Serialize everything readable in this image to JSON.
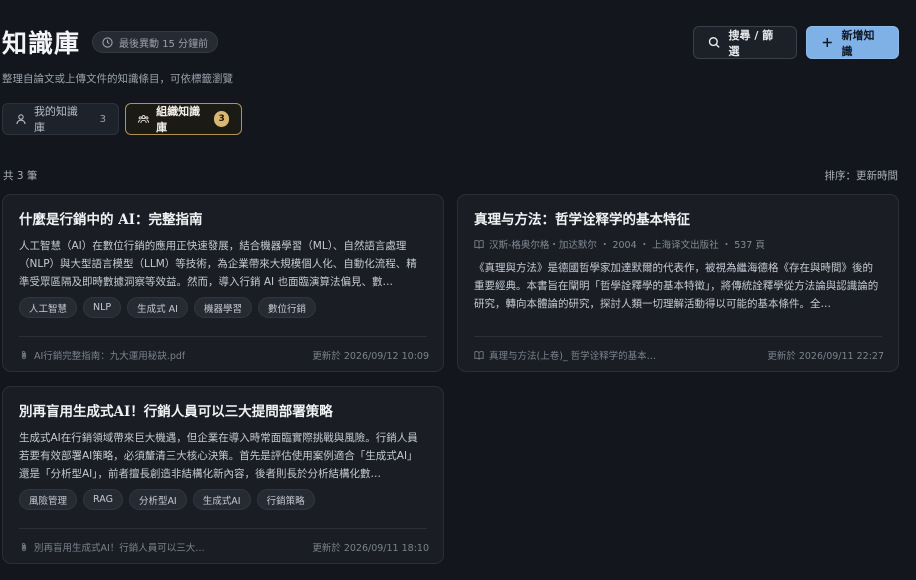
{
  "header": {
    "title": "知識庫",
    "updated_badge": "最後異動 15 分鐘前",
    "subtitle": "整理自論文或上傳文件的知識條目，可依標籤瀏覽",
    "search_button": "搜尋 / 篩選",
    "add_button": "新增知識"
  },
  "tabs": [
    {
      "label": "我的知識庫",
      "count": "3"
    },
    {
      "label": "組織知識庫",
      "count": "3"
    }
  ],
  "results": {
    "count_label": "共 3 筆",
    "sort_label": "排序：更新時間"
  },
  "cards": [
    {
      "title": "什麼是行銷中的 AI：完整指南",
      "description": "人工智慧（AI）在數位行銷的應用正快速發展，結合機器學習（ML）、自然語言處理（NLP）與大型語言模型（LLM）等技術，為企業帶來大規模個人化、自動化流程、精準受眾區隔及即時數據洞察等效益。然而，導入行銷 AI 也面臨演算法偏見、數…",
      "tags": [
        "人工智慧",
        "NLP",
        "生成式 AI",
        "機器學習",
        "數位行銷"
      ],
      "file": "AI行銷完整指南：九大運用秘訣.pdf",
      "updated": "更新於 2026/09/12 10:09"
    },
    {
      "title": "真理与方法：哲学诠释学的基本特征",
      "meta": "汉斯-格奥尔格・加达默尔 ・ 2004 ・ 上海译文出版社 ・ 537 頁",
      "description": "《真理與方法》是德國哲學家加達默爾的代表作，被視為繼海德格《存在與時間》後的重要經典。本書旨在闡明「哲學詮釋學的基本特徵」，將傳統詮釋學從方法論與認識論的研究，轉向本體論的研究，探討人類一切理解活動得以可能的基本條件。全…",
      "file": "真理与方法(上卷)_ 哲学诠释学的基本…",
      "updated": "更新於 2026/09/11 22:27"
    },
    {
      "title": "別再盲用生成式AI！行銷人員可以三大提問部署策略",
      "description": "生成式AI在行銷領域帶來巨大機遇，但企業在導入時常面臨實際挑戰與風險。行銷人員若要有效部署AI策略，必須釐清三大核心決策。首先是評估使用案例適合「生成式AI」還是「分析型AI」，前者擅長創造非結構化新內容，後者則長於分析結構化數…",
      "tags": [
        "風險管理",
        "RAG",
        "分析型AI",
        "生成式AI",
        "行銷策略"
      ],
      "file": "別再盲用生成式AI！行銷人員可以三大…",
      "updated": "更新於 2026/09/11 18:10"
    }
  ],
  "icons": {
    "clock": "clock-icon",
    "search": "search-icon",
    "plus": "plus-icon",
    "user": "user-icon",
    "group": "group-icon",
    "book": "book-icon",
    "paperclip": "paperclip-icon"
  },
  "colors": {
    "accent_blue": "#7fb0e6",
    "accent_gold": "#d9b772",
    "background": "#13161c",
    "card": "#1a1d24"
  }
}
